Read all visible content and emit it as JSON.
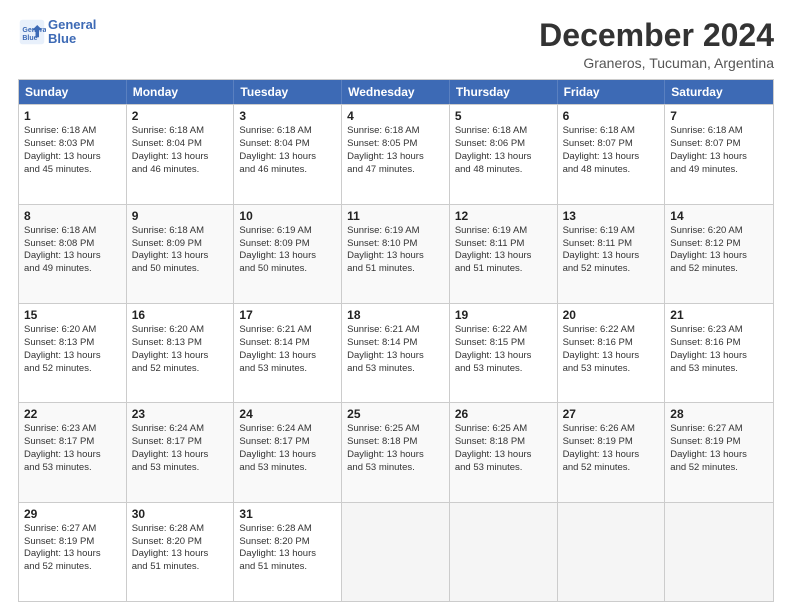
{
  "header": {
    "logo_line1": "General",
    "logo_line2": "Blue",
    "month": "December 2024",
    "location": "Graneros, Tucuman, Argentina"
  },
  "days_of_week": [
    "Sunday",
    "Monday",
    "Tuesday",
    "Wednesday",
    "Thursday",
    "Friday",
    "Saturday"
  ],
  "rows": [
    [
      {
        "day": "1",
        "lines": [
          "Sunrise: 6:18 AM",
          "Sunset: 8:03 PM",
          "Daylight: 13 hours",
          "and 45 minutes."
        ]
      },
      {
        "day": "2",
        "lines": [
          "Sunrise: 6:18 AM",
          "Sunset: 8:04 PM",
          "Daylight: 13 hours",
          "and 46 minutes."
        ]
      },
      {
        "day": "3",
        "lines": [
          "Sunrise: 6:18 AM",
          "Sunset: 8:04 PM",
          "Daylight: 13 hours",
          "and 46 minutes."
        ]
      },
      {
        "day": "4",
        "lines": [
          "Sunrise: 6:18 AM",
          "Sunset: 8:05 PM",
          "Daylight: 13 hours",
          "and 47 minutes."
        ]
      },
      {
        "day": "5",
        "lines": [
          "Sunrise: 6:18 AM",
          "Sunset: 8:06 PM",
          "Daylight: 13 hours",
          "and 48 minutes."
        ]
      },
      {
        "day": "6",
        "lines": [
          "Sunrise: 6:18 AM",
          "Sunset: 8:07 PM",
          "Daylight: 13 hours",
          "and 48 minutes."
        ]
      },
      {
        "day": "7",
        "lines": [
          "Sunrise: 6:18 AM",
          "Sunset: 8:07 PM",
          "Daylight: 13 hours",
          "and 49 minutes."
        ]
      }
    ],
    [
      {
        "day": "8",
        "lines": [
          "Sunrise: 6:18 AM",
          "Sunset: 8:08 PM",
          "Daylight: 13 hours",
          "and 49 minutes."
        ]
      },
      {
        "day": "9",
        "lines": [
          "Sunrise: 6:18 AM",
          "Sunset: 8:09 PM",
          "Daylight: 13 hours",
          "and 50 minutes."
        ]
      },
      {
        "day": "10",
        "lines": [
          "Sunrise: 6:19 AM",
          "Sunset: 8:09 PM",
          "Daylight: 13 hours",
          "and 50 minutes."
        ]
      },
      {
        "day": "11",
        "lines": [
          "Sunrise: 6:19 AM",
          "Sunset: 8:10 PM",
          "Daylight: 13 hours",
          "and 51 minutes."
        ]
      },
      {
        "day": "12",
        "lines": [
          "Sunrise: 6:19 AM",
          "Sunset: 8:11 PM",
          "Daylight: 13 hours",
          "and 51 minutes."
        ]
      },
      {
        "day": "13",
        "lines": [
          "Sunrise: 6:19 AM",
          "Sunset: 8:11 PM",
          "Daylight: 13 hours",
          "and 52 minutes."
        ]
      },
      {
        "day": "14",
        "lines": [
          "Sunrise: 6:20 AM",
          "Sunset: 8:12 PM",
          "Daylight: 13 hours",
          "and 52 minutes."
        ]
      }
    ],
    [
      {
        "day": "15",
        "lines": [
          "Sunrise: 6:20 AM",
          "Sunset: 8:13 PM",
          "Daylight: 13 hours",
          "and 52 minutes."
        ]
      },
      {
        "day": "16",
        "lines": [
          "Sunrise: 6:20 AM",
          "Sunset: 8:13 PM",
          "Daylight: 13 hours",
          "and 52 minutes."
        ]
      },
      {
        "day": "17",
        "lines": [
          "Sunrise: 6:21 AM",
          "Sunset: 8:14 PM",
          "Daylight: 13 hours",
          "and 53 minutes."
        ]
      },
      {
        "day": "18",
        "lines": [
          "Sunrise: 6:21 AM",
          "Sunset: 8:14 PM",
          "Daylight: 13 hours",
          "and 53 minutes."
        ]
      },
      {
        "day": "19",
        "lines": [
          "Sunrise: 6:22 AM",
          "Sunset: 8:15 PM",
          "Daylight: 13 hours",
          "and 53 minutes."
        ]
      },
      {
        "day": "20",
        "lines": [
          "Sunrise: 6:22 AM",
          "Sunset: 8:16 PM",
          "Daylight: 13 hours",
          "and 53 minutes."
        ]
      },
      {
        "day": "21",
        "lines": [
          "Sunrise: 6:23 AM",
          "Sunset: 8:16 PM",
          "Daylight: 13 hours",
          "and 53 minutes."
        ]
      }
    ],
    [
      {
        "day": "22",
        "lines": [
          "Sunrise: 6:23 AM",
          "Sunset: 8:17 PM",
          "Daylight: 13 hours",
          "and 53 minutes."
        ]
      },
      {
        "day": "23",
        "lines": [
          "Sunrise: 6:24 AM",
          "Sunset: 8:17 PM",
          "Daylight: 13 hours",
          "and 53 minutes."
        ]
      },
      {
        "day": "24",
        "lines": [
          "Sunrise: 6:24 AM",
          "Sunset: 8:17 PM",
          "Daylight: 13 hours",
          "and 53 minutes."
        ]
      },
      {
        "day": "25",
        "lines": [
          "Sunrise: 6:25 AM",
          "Sunset: 8:18 PM",
          "Daylight: 13 hours",
          "and 53 minutes."
        ]
      },
      {
        "day": "26",
        "lines": [
          "Sunrise: 6:25 AM",
          "Sunset: 8:18 PM",
          "Daylight: 13 hours",
          "and 53 minutes."
        ]
      },
      {
        "day": "27",
        "lines": [
          "Sunrise: 6:26 AM",
          "Sunset: 8:19 PM",
          "Daylight: 13 hours",
          "and 52 minutes."
        ]
      },
      {
        "day": "28",
        "lines": [
          "Sunrise: 6:27 AM",
          "Sunset: 8:19 PM",
          "Daylight: 13 hours",
          "and 52 minutes."
        ]
      }
    ],
    [
      {
        "day": "29",
        "lines": [
          "Sunrise: 6:27 AM",
          "Sunset: 8:19 PM",
          "Daylight: 13 hours",
          "and 52 minutes."
        ]
      },
      {
        "day": "30",
        "lines": [
          "Sunrise: 6:28 AM",
          "Sunset: 8:20 PM",
          "Daylight: 13 hours",
          "and 51 minutes."
        ]
      },
      {
        "day": "31",
        "lines": [
          "Sunrise: 6:28 AM",
          "Sunset: 8:20 PM",
          "Daylight: 13 hours",
          "and 51 minutes."
        ]
      },
      {
        "day": "",
        "lines": []
      },
      {
        "day": "",
        "lines": []
      },
      {
        "day": "",
        "lines": []
      },
      {
        "day": "",
        "lines": []
      }
    ]
  ]
}
